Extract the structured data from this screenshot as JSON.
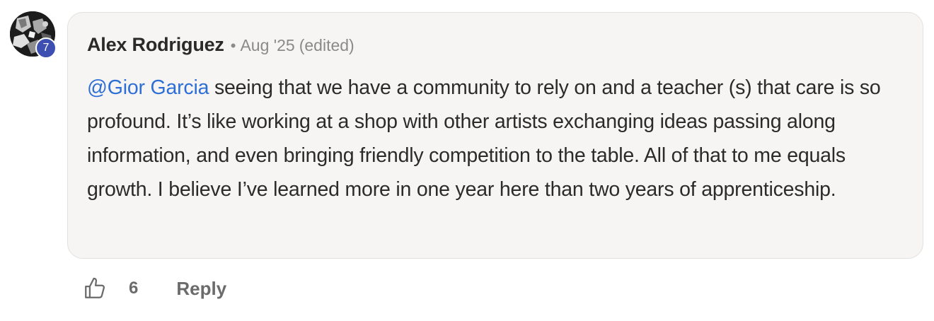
{
  "comment": {
    "author": "Alex Rodriguez",
    "separator": "•",
    "timestamp": "Aug '25",
    "edited_label": "(edited)",
    "level": "7",
    "mention": "@Gior Garcia",
    "body": " seeing that we have a community to rely on and a teacher (s) that care is so profound. It’s like working at a shop with other artists exchanging ideas passing along information, and even bringing friendly competition to the table. All of that to me equals growth. I believe I’ve learned more in one year here than two years of apprenticeship."
  },
  "actions": {
    "like_icon": "thumbs-up-icon",
    "like_count": "6",
    "reply_label": "Reply"
  },
  "colors": {
    "mention": "#2e6fd6",
    "badge": "#3d4fb0",
    "bubble_bg": "#f6f5f4",
    "muted_text": "#8a8a8a"
  }
}
